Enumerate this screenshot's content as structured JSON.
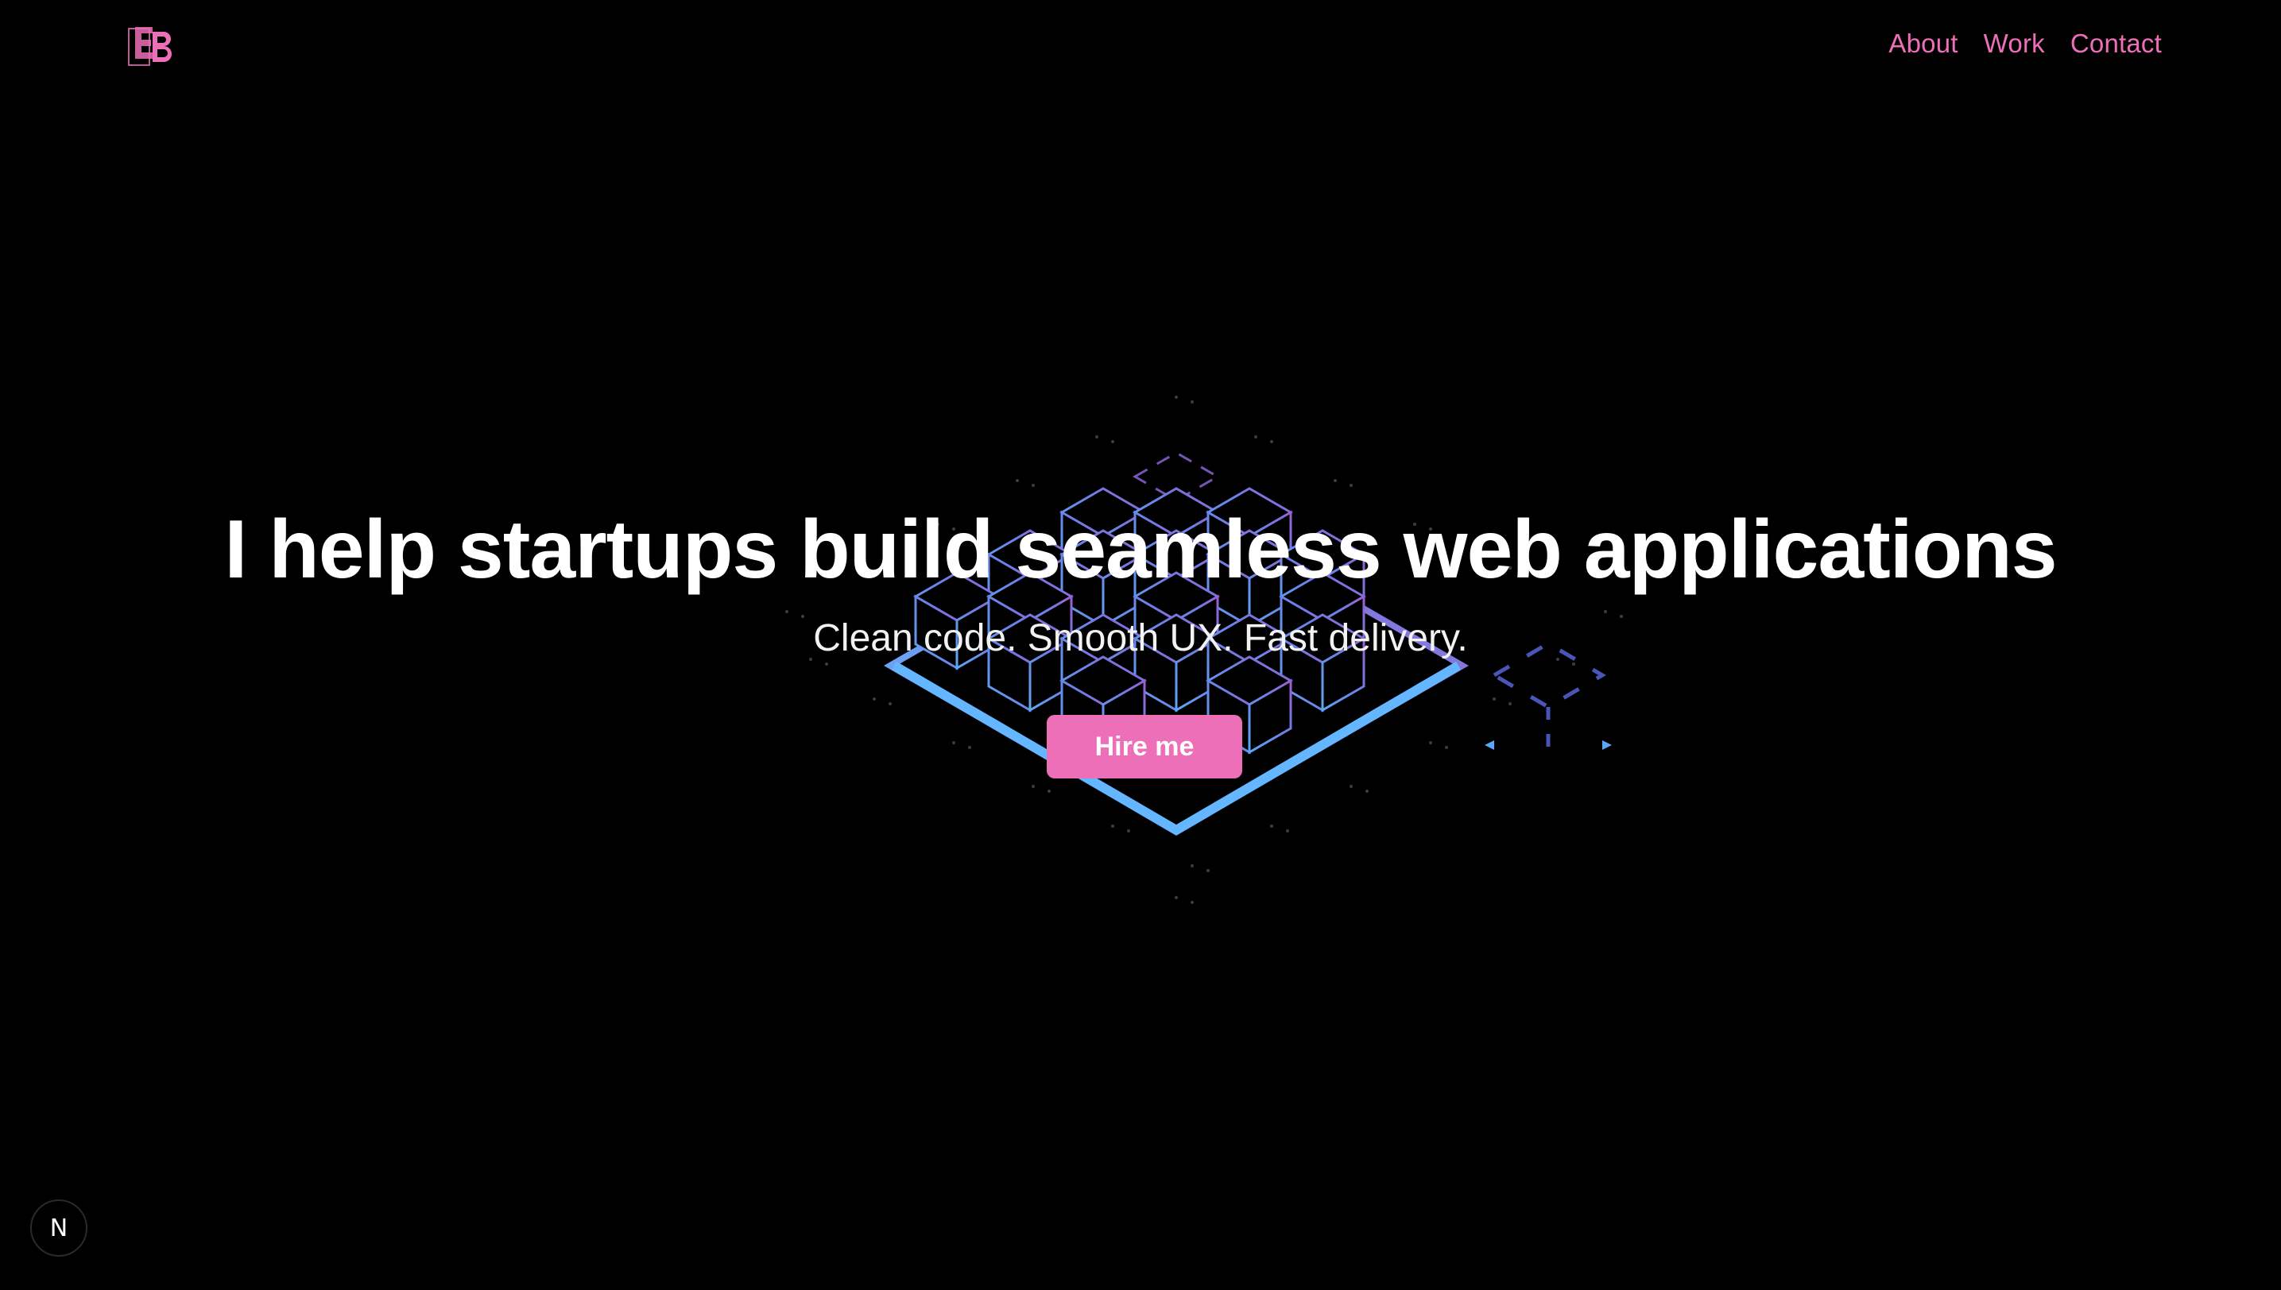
{
  "header": {
    "logo_text": "EB",
    "nav": [
      {
        "label": "About"
      },
      {
        "label": "Work"
      },
      {
        "label": "Contact"
      }
    ]
  },
  "hero": {
    "title": "I help startups build seamless web applications",
    "subtitle": "Clean code. Smooth UX. Fast delivery.",
    "cta_label": "Hire me"
  },
  "dev_indicator": {
    "label": "N"
  },
  "colors": {
    "accent": "#ec6fb8",
    "background": "#000000",
    "cube_blue": "#5aa8f5",
    "cube_purple": "#8a63d2"
  },
  "icons": {
    "logo": "eb-logo-icon",
    "dev_indicator": "nextjs-icon"
  }
}
